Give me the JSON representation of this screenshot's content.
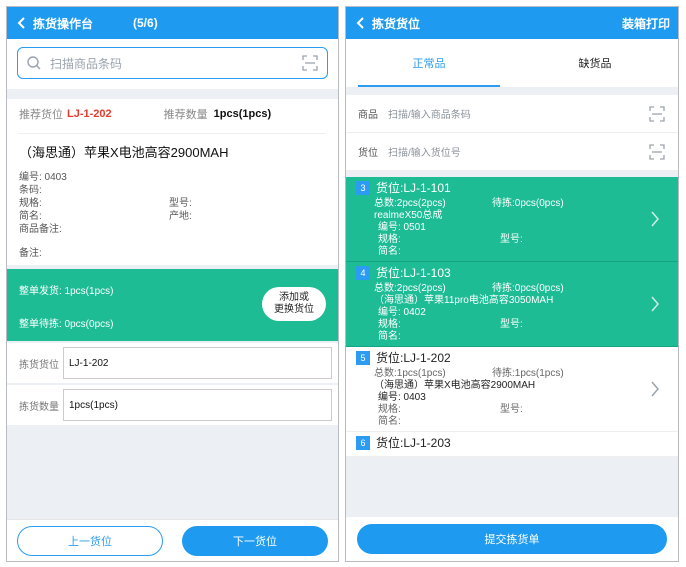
{
  "left": {
    "header": {
      "title": "拣货操作台",
      "progress": "(5/6)"
    },
    "search": {
      "placeholder": "扫描商品条码"
    },
    "recommend": {
      "loc_label": "推荐货位",
      "loc_value": "LJ-1-202",
      "qty_label": "推荐数量",
      "qty_value": "1pcs(1pcs)"
    },
    "product": {
      "title": "（海思通）苹果X电池高容2900MAH",
      "code": "编号: 0403",
      "barcode": "条码:",
      "spec": "规格:",
      "model": "型号:",
      "short": "简名:",
      "origin": "产地:",
      "goods_remark": "商品备注:",
      "remark": "备注:"
    },
    "green": {
      "shipped": "整单发货: 1pcs(1pcs)",
      "pending": "整单待拣: 0pcs(0pcs)",
      "btn_line1": "添加或",
      "btn_line2": "更换货位"
    },
    "fields": [
      {
        "label": "拣货货位",
        "value": "LJ-1-202"
      },
      {
        "label": "拣货数量",
        "value": "1pcs(1pcs)"
      }
    ],
    "footer": {
      "prev": "上一货位",
      "next": "下一货位"
    }
  },
  "right": {
    "header": {
      "title": "拣货货位",
      "action": "装箱打印"
    },
    "tabs": [
      {
        "label": "正常品"
      },
      {
        "label": "缺货品"
      }
    ],
    "inputs": [
      {
        "label": "商品",
        "placeholder": "扫描/输入商品条码"
      },
      {
        "label": "货位",
        "placeholder": "扫描/输入货位号"
      }
    ],
    "cards": [
      {
        "index": "3",
        "location": "货位:LJ-1-101",
        "total": "总数:2pcs(2pcs)",
        "pending": "待拣:0pcs(0pcs)",
        "name": "realmeX50总成",
        "code": "编号:  0501",
        "spec": "规格:",
        "model": "型号:",
        "short": "简名:"
      },
      {
        "index": "4",
        "location": "货位:LJ-1-103",
        "total": "总数:2pcs(2pcs)",
        "pending": "待拣:0pcs(0pcs)",
        "name": "（海思通）苹果11pro电池高容3050MAH",
        "code": "编号:  0402",
        "spec": "规格:",
        "model": "型号:",
        "short": "简名:"
      },
      {
        "index": "5",
        "location": "货位:LJ-1-202",
        "total": "总数:1pcs(1pcs)",
        "pending": "待拣:1pcs(1pcs)",
        "name": "（海思通）苹果X电池高容2900MAH",
        "code": "编号:  0403",
        "spec": "规格:",
        "model": "型号:",
        "short": "简名:"
      },
      {
        "index": "6",
        "location": "货位:LJ-1-203"
      }
    ],
    "footer": {
      "submit": "提交拣货单"
    }
  },
  "colors": {
    "primary": "#1e9bf0",
    "green": "#1dbc95",
    "red": "#e33b2e"
  },
  "icons": [
    "back-arrow-icon",
    "search-icon",
    "scan-icon",
    "chevron-right-icon"
  ]
}
